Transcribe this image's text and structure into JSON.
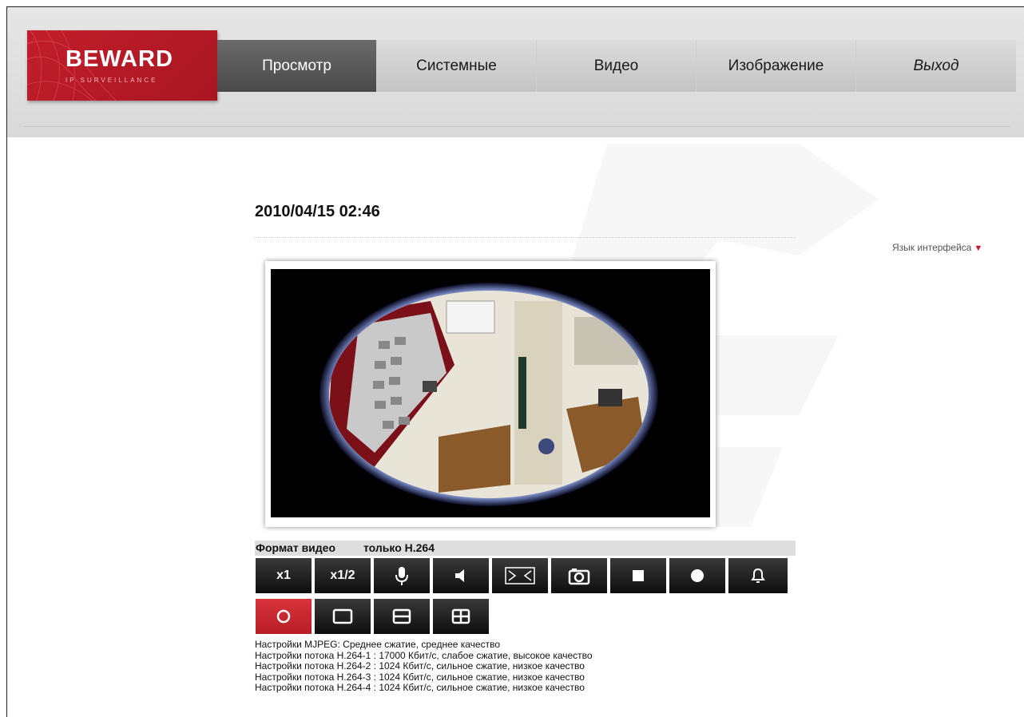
{
  "logo": {
    "brand": "BEWARD",
    "tagline": "IP SURVEILLANCE"
  },
  "nav": [
    {
      "label": "Просмотр"
    },
    {
      "label": "Системные"
    },
    {
      "label": "Видео"
    },
    {
      "label": "Изображение"
    },
    {
      "label": "Выход"
    }
  ],
  "timestamp": "2010/04/15 02:46",
  "language": {
    "label": "Язык интерфейса"
  },
  "format": {
    "label": "Формат видео",
    "value": "только H.264"
  },
  "controls": [
    {
      "label": "x1"
    },
    {
      "label": "x1/2"
    },
    {
      "icon": "microphone-icon"
    },
    {
      "icon": "speaker-icon"
    },
    {
      "icon": "fullscreen-icon"
    },
    {
      "icon": "camera-icon"
    },
    {
      "icon": "stop-icon"
    },
    {
      "icon": "record-icon"
    },
    {
      "icon": "bell-icon"
    }
  ],
  "view_modes": [
    {
      "icon": "fisheye-circle-icon"
    },
    {
      "icon": "single-view-icon"
    },
    {
      "icon": "double-view-icon"
    },
    {
      "icon": "quad-view-icon"
    }
  ],
  "settings": [
    "Настройки MJPEG: Среднее сжатие, среднее качество",
    "Настройки потока H.264-1 : 17000 Кбит/с, слабое сжатие, высокое качество",
    "Настройки потока H.264-2 : 1024 Кбит/с, сильное сжатие, низкое качество",
    "Настройки потока H.264-3 : 1024 Кбит/с, сильное сжатие, низкое качество",
    "Настройки потока H.264-4 : 1024 Кбит/с, сильное сжатие, низкое качество"
  ],
  "colors": {
    "accent": "#c21e2b",
    "active_nav": "#555555",
    "header_bg": "#dddddd"
  }
}
